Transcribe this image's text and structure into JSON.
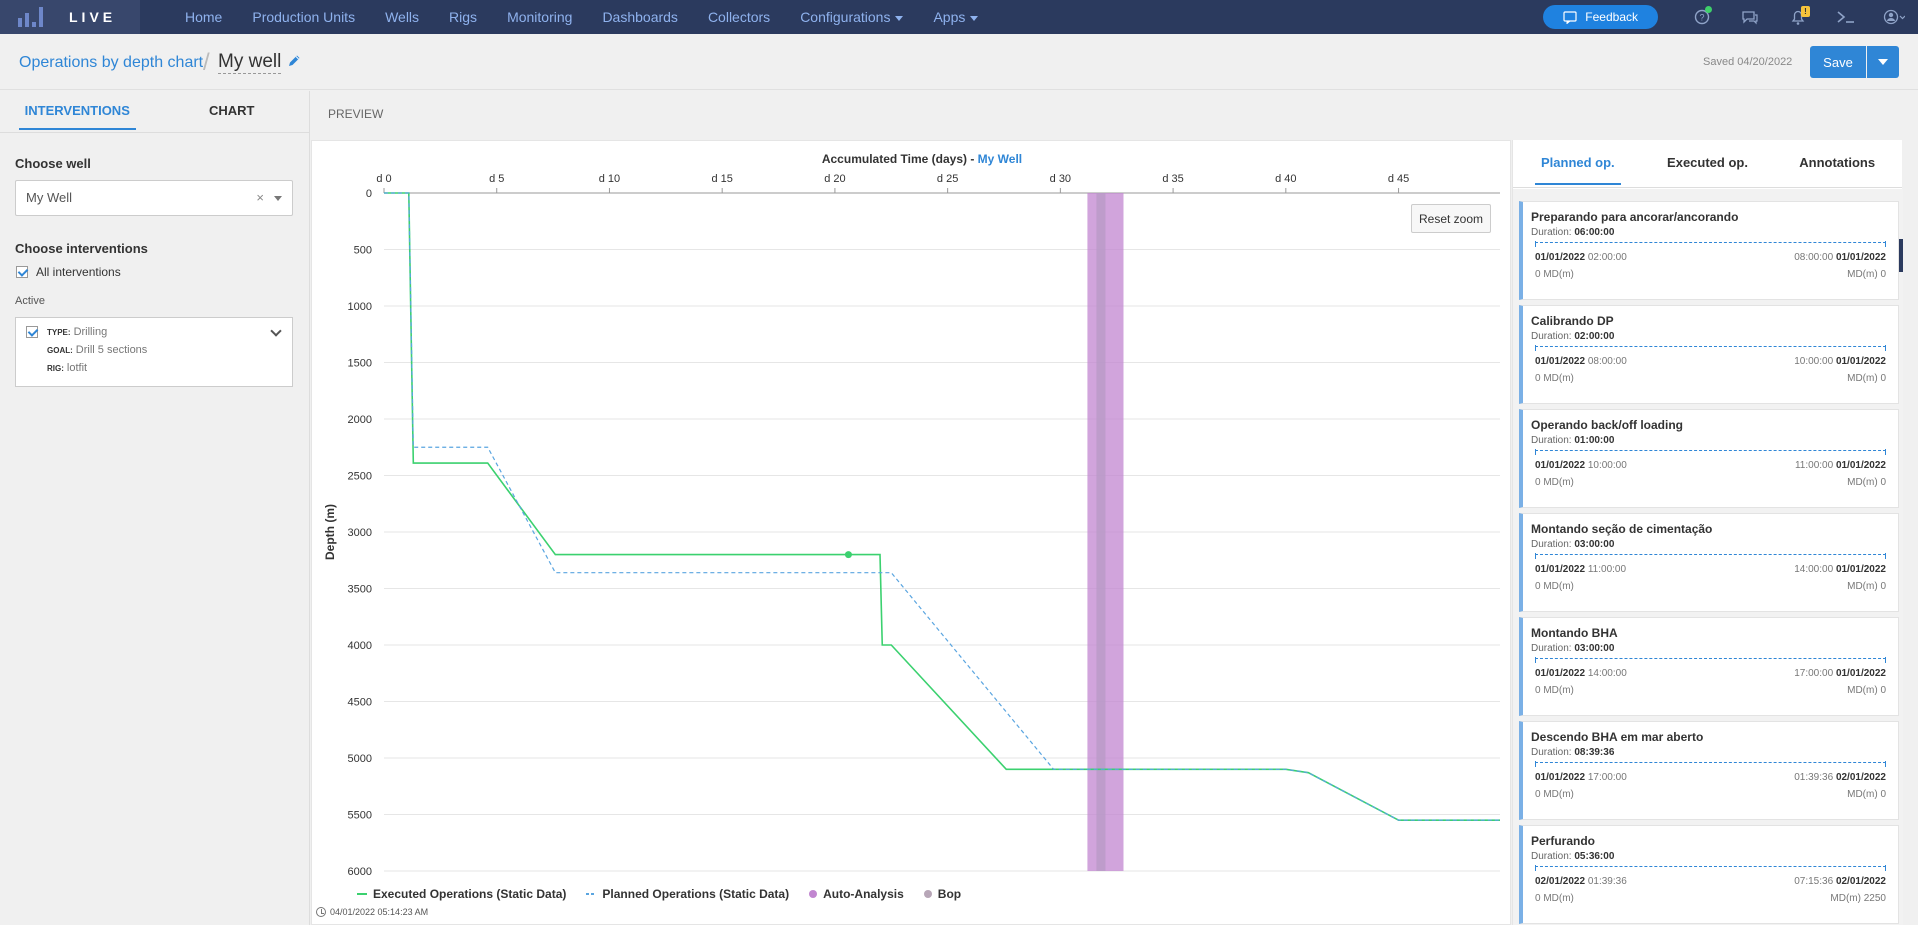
{
  "topnav": {
    "brand": "LIVE",
    "items": [
      {
        "label": "Home"
      },
      {
        "label": "Production Units"
      },
      {
        "label": "Wells"
      },
      {
        "label": "Rigs"
      },
      {
        "label": "Monitoring"
      },
      {
        "label": "Dashboards"
      },
      {
        "label": "Collectors"
      },
      {
        "label": "Configurations",
        "dropdown": true
      },
      {
        "label": "Apps",
        "dropdown": true
      }
    ],
    "feedback_label": "Feedback",
    "notification_badge": "!",
    "icons": [
      "help-icon",
      "chat-icon",
      "bell-icon",
      "terminal-icon",
      "user-icon"
    ],
    "colors": {
      "bar": "#2b3a5e",
      "link": "#8fb2ee",
      "feedback": "#1f82e0"
    }
  },
  "header": {
    "breadcrumb": "Operations by depth chart",
    "well_name": "My well",
    "saved": "Saved 04/20/2022",
    "save_label": "Save"
  },
  "left": {
    "tabs": [
      "INTERVENTIONS",
      "CHART"
    ],
    "choose_well_label": "Choose well",
    "selected_well": "My Well",
    "clear_symbol": "×",
    "choose_interventions_label": "Choose interventions",
    "all_interventions_label": "All interventions",
    "active_label": "Active",
    "intervention": {
      "type_key": "TYPE:",
      "type": "Drilling",
      "goal_key": "GOAL:",
      "goal": "Drill 5 sections",
      "rig_key": "RIG:",
      "rig": "lotfit"
    }
  },
  "center": {
    "preview_label": "PREVIEW",
    "reset_zoom": "Reset zoom",
    "timestamp": "04/01/2022 05:14:23 AM"
  },
  "chart_data": {
    "type": "line",
    "title": "Accumulated Time (days) - ",
    "title_well": "My Well",
    "ylabel": "Depth (m)",
    "xlim": [
      0,
      49.5
    ],
    "ylim": [
      0,
      6000
    ],
    "y_inverted": true,
    "x_axis_position": "top",
    "x_ticks": [
      0,
      5,
      10,
      15,
      20,
      25,
      30,
      35,
      40,
      45
    ],
    "x_tick_labels": [
      "d 0",
      "d 5",
      "d 10",
      "d 15",
      "d 20",
      "d 25",
      "d 30",
      "d 35",
      "d 40",
      "d 45"
    ],
    "y_ticks": [
      0,
      500,
      1000,
      1500,
      2000,
      2500,
      3000,
      3500,
      4000,
      4500,
      5000,
      5500,
      6000
    ],
    "y_tick_labels": [
      "0",
      "500",
      "1000",
      "1500",
      "2000",
      "2500",
      "3000",
      "3500",
      "4000",
      "4500",
      "5000",
      "5500",
      "6000"
    ],
    "grid": true,
    "series": [
      {
        "name": "Executed Operations (Static Data)",
        "color": "#3bd16f",
        "style": "solid",
        "points": [
          [
            0,
            0
          ],
          [
            1.1,
            0
          ],
          [
            1.3,
            2390
          ],
          [
            4.6,
            2390
          ],
          [
            7.6,
            3200
          ],
          [
            22,
            3200
          ],
          [
            22.1,
            4000
          ],
          [
            22.5,
            4000
          ],
          [
            27.6,
            5100
          ],
          [
            40,
            5100
          ],
          [
            41,
            5130
          ],
          [
            45,
            5550
          ],
          [
            49.5,
            5550
          ]
        ],
        "marker_point": [
          20.6,
          3200
        ]
      },
      {
        "name": "Planned Operations (Static Data)",
        "color": "#5aa5e0",
        "style": "dashed",
        "points": [
          [
            0,
            0
          ],
          [
            1.1,
            0
          ],
          [
            1.3,
            2250
          ],
          [
            4.6,
            2250
          ],
          [
            7.6,
            3360
          ],
          [
            22.5,
            3360
          ],
          [
            29.7,
            5100
          ],
          [
            40,
            5100
          ],
          [
            41,
            5130
          ],
          [
            45,
            5550
          ],
          [
            49.5,
            5550
          ]
        ]
      }
    ],
    "bands": [
      {
        "name": "Auto-Analysis",
        "color": "#c186d0",
        "x0": 31.2,
        "x1": 32.8
      },
      {
        "name": "Bop",
        "color": "#b79ac5",
        "x0": 31.6,
        "x1": 32.0
      }
    ],
    "legend": [
      {
        "name": "Executed Operations (Static Data)",
        "color": "#3bd16f",
        "marker": "line"
      },
      {
        "name": "Planned Operations (Static Data)",
        "color": "#5aa5e0",
        "marker": "dashline"
      },
      {
        "name": "Auto-Analysis",
        "color": "#c186d0",
        "marker": "dot"
      },
      {
        "name": "Bop",
        "color": "#b7a6b7",
        "marker": "dot"
      }
    ],
    "legend_position": "bottom-left"
  },
  "right": {
    "tabs": [
      "Planned op.",
      "Executed op.",
      "Annotations"
    ],
    "operations": [
      {
        "title": "Preparando para ancorar/ancorando",
        "duration": "06:00:00",
        "start_date": "01/01/2022",
        "start_time": "02:00:00",
        "end_time": "08:00:00",
        "end_date": "01/01/2022",
        "md_start": "0",
        "md_end": "0"
      },
      {
        "title": "Calibrando DP",
        "duration": "02:00:00",
        "start_date": "01/01/2022",
        "start_time": "08:00:00",
        "end_time": "10:00:00",
        "end_date": "01/01/2022",
        "md_start": "0",
        "md_end": "0"
      },
      {
        "title": "Operando back/off loading",
        "duration": "01:00:00",
        "start_date": "01/01/2022",
        "start_time": "10:00:00",
        "end_time": "11:00:00",
        "end_date": "01/01/2022",
        "md_start": "0",
        "md_end": "0"
      },
      {
        "title": "Montando seção de cimentação",
        "duration": "03:00:00",
        "start_date": "01/01/2022",
        "start_time": "11:00:00",
        "end_time": "14:00:00",
        "end_date": "01/01/2022",
        "md_start": "0",
        "md_end": "0"
      },
      {
        "title": "Montando BHA",
        "duration": "03:00:00",
        "start_date": "01/01/2022",
        "start_time": "14:00:00",
        "end_time": "17:00:00",
        "end_date": "01/01/2022",
        "md_start": "0",
        "md_end": "0"
      },
      {
        "title": "Descendo BHA em mar aberto",
        "duration": "08:39:36",
        "start_date": "01/01/2022",
        "start_time": "17:00:00",
        "end_time": "01:39:36",
        "end_date": "02/01/2022",
        "md_start": "0",
        "md_end": "0"
      },
      {
        "title": "Perfurando",
        "duration": "05:36:00",
        "start_date": "02/01/2022",
        "start_time": "01:39:36",
        "end_time": "07:15:36",
        "end_date": "02/01/2022",
        "md_start": "0",
        "md_end": "2250"
      }
    ],
    "duration_key": "Duration:",
    "md_label": "MD(m)"
  }
}
